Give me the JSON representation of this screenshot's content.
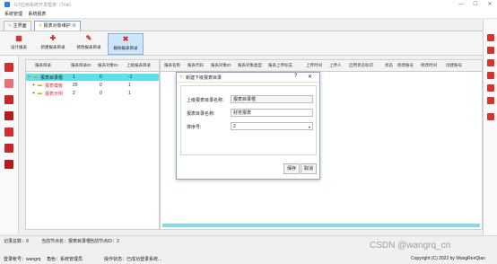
{
  "window": {
    "title": "GT应用系统开发框架（Trial）",
    "controls": [
      "—",
      "☐",
      "✕"
    ]
  },
  "menu": {
    "items": [
      "系统管理",
      "系统报表"
    ]
  },
  "tabs": [
    {
      "label": "主界面"
    },
    {
      "label": "报表对象维护",
      "close": "⊗"
    }
  ],
  "toolbar": {
    "buttons": [
      {
        "label": "设计报表",
        "icon": "report-design-icon",
        "color": "#c62828"
      },
      {
        "label": "新建报表目录",
        "icon": "plus-icon",
        "color": "#d32f2f"
      },
      {
        "label": "修改报表目录",
        "icon": "edit-icon",
        "color": "#d32f2f"
      },
      {
        "label": "删除报表目录",
        "icon": "delete-icon",
        "color": "#d32f2f"
      }
    ]
  },
  "tree": {
    "columns": [
      "报表目录",
      "报表目录ID",
      "报表对象ID",
      "上级报表目录"
    ],
    "rows": [
      {
        "expander": "−",
        "name": "报表目录根",
        "id": "1",
        "obj": "0",
        "parent": "-1",
        "selected": true
      },
      {
        "expander": "+",
        "name": "报表模板",
        "id": "20",
        "obj": "0",
        "parent": "1",
        "selected": false
      },
      {
        "expander": "+",
        "name": "报表示例",
        "id": "2",
        "obj": "0",
        "parent": "1",
        "selected": false
      }
    ]
  },
  "grid": {
    "columns": [
      "报表名称",
      "报表代码",
      "报表对象ID",
      "报表对象类型",
      "报表上传标志",
      "上传时间",
      "上传人",
      "启用状态标识",
      "状态",
      "修改账号",
      "修改时间",
      "创建账号"
    ]
  },
  "dialog": {
    "title": "新建下级报表目录",
    "help": "?",
    "close": "✕",
    "fields": [
      {
        "label": "上级报表目录名称:",
        "value": "报表目录根",
        "readonly": true
      },
      {
        "label": "报表目录名称:",
        "value": "财务报表",
        "readonly": false
      },
      {
        "label": "排序号:",
        "value": "2",
        "readonly": false
      }
    ],
    "save_label": "保存",
    "cancel_label": "取消"
  },
  "status": {
    "record_count": "记录总数：9",
    "current_node": "当前节点名：报表目录根",
    "current_node_id": "当前节点ID：2"
  },
  "footer": {
    "account": "登录帐号：wangrq",
    "role": "角色：系统管理员",
    "op_status": "操作状态：已成功登录系统...",
    "copyright": "Copyright (C) 2022 by WangRenQian"
  },
  "watermark": "CSDN @wangrq_cn"
}
